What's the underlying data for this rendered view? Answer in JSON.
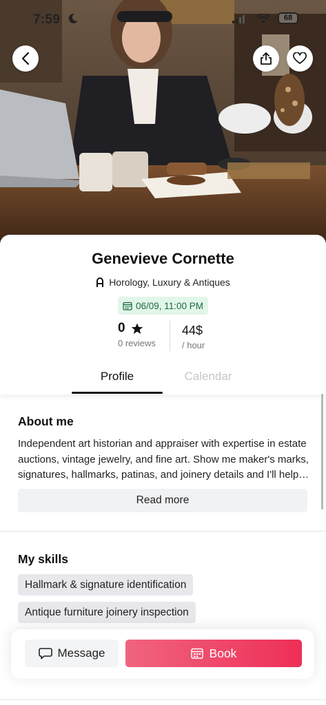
{
  "status_bar": {
    "time": "7:59",
    "battery": "68"
  },
  "profile": {
    "name": "Genevieve Cornette",
    "category": "Horology, Luxury & Antiques",
    "date": "06/09, 11:00 PM",
    "rating": "0",
    "reviews": "0 reviews",
    "price": "44$",
    "price_unit": "/ hour"
  },
  "tabs": [
    {
      "label": "Profile",
      "active": true
    },
    {
      "label": "Calendar",
      "active": false
    }
  ],
  "about": {
    "title": "About me",
    "text": "Independent art historian and appraiser with expertise in estate auctions, vintage jewelry, and fine art. Show me maker's marks, signatures, hallmarks, patinas, and joinery details and I'll help you understand provenance and value.",
    "read_more": "Read more"
  },
  "skills": {
    "title": "My skills",
    "items": [
      "Hallmark & signature identification",
      "Antique furniture joinery inspection"
    ]
  },
  "actions": {
    "message": "Message",
    "book": "Book"
  },
  "colors": {
    "accent": "#ee2f57",
    "badge_bg": "#e2f6ea",
    "badge_text": "#1e6b3f"
  },
  "icons": [
    "back-icon",
    "share-icon",
    "heart-icon",
    "category-icon",
    "calendar-icon",
    "star-icon",
    "chat-icon"
  ]
}
